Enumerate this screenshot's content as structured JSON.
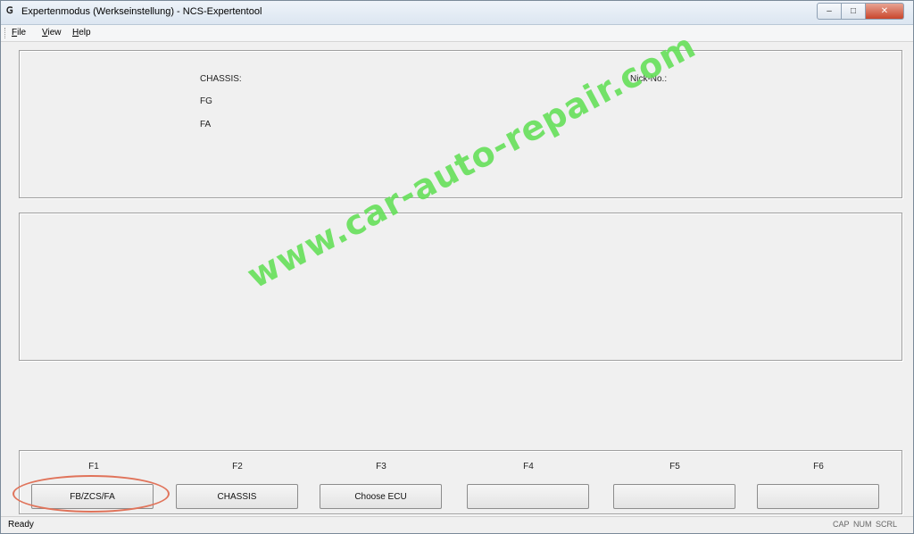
{
  "window": {
    "title": "Expertenmodus (Werkseinstellung) - NCS-Expertentool",
    "icon": "app-icon"
  },
  "menu": {
    "items": [
      {
        "label": "File",
        "accel": "F",
        "rest": "ile"
      },
      {
        "label": "View",
        "accel": "V",
        "rest": "iew"
      },
      {
        "label": "Help",
        "accel": "H",
        "rest": "elp"
      }
    ]
  },
  "info": {
    "chassis_label": "CHASSIS:",
    "fg_label": "FG",
    "fa_label": "FA",
    "nick_label": "Nick-No.:"
  },
  "function_keys": [
    {
      "key": "F1",
      "label": "FB/ZCS/FA"
    },
    {
      "key": "F2",
      "label": "CHASSIS"
    },
    {
      "key": "F3",
      "label": "Choose ECU"
    },
    {
      "key": "F4",
      "label": ""
    },
    {
      "key": "F5",
      "label": ""
    },
    {
      "key": "F6",
      "label": ""
    }
  ],
  "status": {
    "text": "Ready",
    "indicators": [
      "CAP",
      "NUM",
      "SCRL"
    ]
  },
  "watermark": "www.car-auto-repair.com",
  "colors": {
    "watermark": "#66e05a",
    "highlight": "#e0735a"
  }
}
